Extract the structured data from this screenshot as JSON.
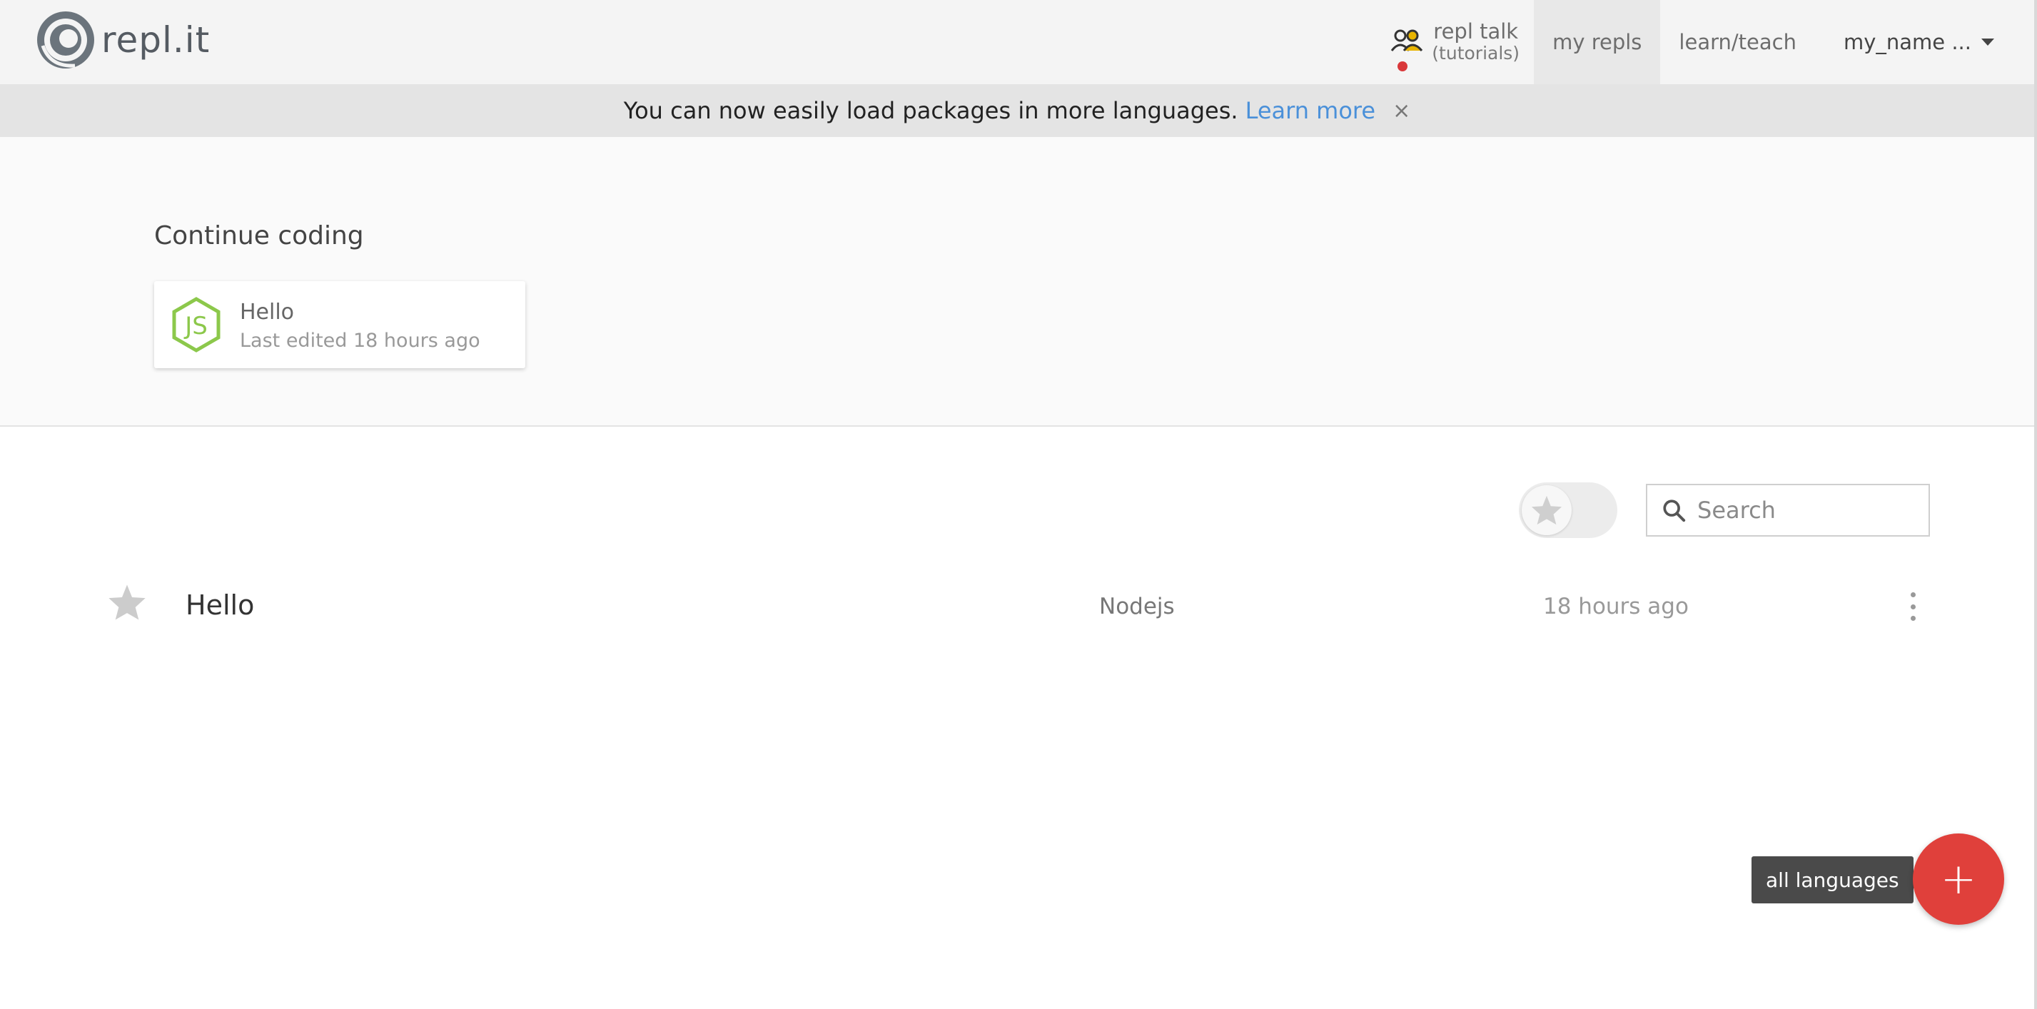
{
  "header": {
    "logo_text": "repl.it",
    "nav": {
      "talk_label": "repl talk",
      "talk_sub": "(tutorials)",
      "my_repls": "my repls",
      "learn_teach": "learn/teach",
      "user": "my_name ..."
    }
  },
  "banner": {
    "message": "You can now easily load packages in more languages.",
    "link": "Learn more",
    "close": "×"
  },
  "continue": {
    "heading": "Continue coding",
    "card": {
      "title": "Hello",
      "subtitle": "Last edited 18 hours ago",
      "icon": "nodejs-icon"
    }
  },
  "toolbar": {
    "search_placeholder": "Search"
  },
  "repls": [
    {
      "name": "Hello",
      "language": "Nodejs",
      "time": "18 hours ago"
    }
  ],
  "fab": {
    "tooltip": "all languages",
    "symbol": "+"
  },
  "colors": {
    "accent_red": "#e0403b",
    "link_blue": "#4a90d9",
    "node_green": "#8cc84b"
  }
}
